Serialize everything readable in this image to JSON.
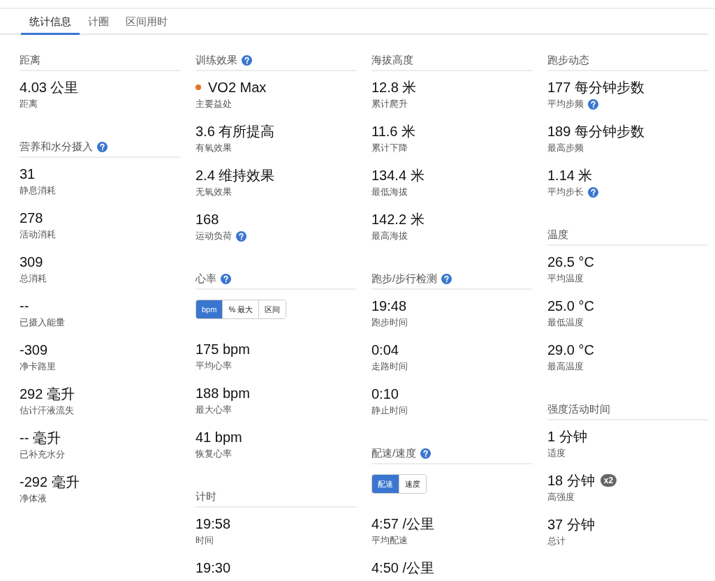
{
  "tabs": [
    {
      "label": "统计信息",
      "selected": true
    },
    {
      "label": "计圈",
      "selected": false
    },
    {
      "label": "区间用时",
      "selected": false
    }
  ],
  "columns": [
    {
      "sections": [
        {
          "title": "距离",
          "stats": [
            {
              "value": "4.03 公里",
              "label": "距离"
            }
          ]
        },
        {
          "title": "营养和水分摄入",
          "help": true,
          "stats": [
            {
              "value": "31",
              "label": "静息消耗"
            },
            {
              "value": "278",
              "label": "活动消耗"
            },
            {
              "value": "309",
              "label": "总消耗"
            },
            {
              "value": "--",
              "label": "已摄入能量"
            },
            {
              "value": "-309",
              "label": "净卡路里"
            },
            {
              "value": "292 毫升",
              "label": "估计汗液流失"
            },
            {
              "value": "-- 毫升",
              "label": "已补充水分"
            },
            {
              "value": "-292 毫升",
              "label": "净体液"
            }
          ]
        }
      ]
    },
    {
      "sections": [
        {
          "title": "训练效果",
          "help": true,
          "stats": [
            {
              "value": "VO2 Max",
              "label": "主要益处",
              "color": "#e8702a"
            },
            {
              "value": "3.6 有所提高",
              "label": "有氧效果"
            },
            {
              "value": "2.4 维持效果",
              "label": "无氧效果"
            },
            {
              "value": "168",
              "label": "运动负荷",
              "help": true
            }
          ]
        },
        {
          "title": "心率",
          "help": true,
          "toggle": [
            {
              "label": "bpm",
              "selected": true
            },
            {
              "label": "% 最大",
              "selected": false
            },
            {
              "label": "区间",
              "selected": false
            }
          ],
          "stats": [
            {
              "value": "175 bpm",
              "label": "平均心率"
            },
            {
              "value": "188 bpm",
              "label": "最大心率"
            },
            {
              "value": "41 bpm",
              "label": "恢复心率"
            }
          ]
        },
        {
          "title": "计时",
          "stats": [
            {
              "value": "19:58",
              "label": "时间"
            },
            {
              "value": "19:30"
            }
          ]
        }
      ]
    },
    {
      "sections": [
        {
          "title": "海拔高度",
          "stats": [
            {
              "value": "12.8 米",
              "label": "累计爬升"
            },
            {
              "value": "11.6 米",
              "label": "累计下降"
            },
            {
              "value": "134.4 米",
              "label": "最低海拔"
            },
            {
              "value": "142.2 米",
              "label": "最高海拔"
            }
          ]
        },
        {
          "title": "跑步/步行检测",
          "help": true,
          "stats": [
            {
              "value": "19:48",
              "label": "跑步时间"
            },
            {
              "value": "0:04",
              "label": "走路时间"
            },
            {
              "value": "0:10",
              "label": "静止时间"
            }
          ]
        },
        {
          "title": "配速/速度",
          "help": true,
          "toggle": [
            {
              "label": "配速",
              "selected": true
            },
            {
              "label": "速度",
              "selected": false
            }
          ],
          "stats": [
            {
              "value": "4:57 /公里",
              "label": "平均配速"
            },
            {
              "value": "4:50 /公里"
            }
          ]
        }
      ]
    },
    {
      "sections": [
        {
          "title": "跑步动态",
          "stats": [
            {
              "value": "177 每分钟步数",
              "label": "平均步频",
              "help": true
            },
            {
              "value": "189 每分钟步数",
              "label": "最高步频"
            },
            {
              "value": "1.14 米",
              "label": "平均步长",
              "help": true
            }
          ]
        },
        {
          "title": "温度",
          "stats": [
            {
              "value": "26.5 °C",
              "label": "平均温度"
            },
            {
              "value": "25.0 °C",
              "label": "最低温度"
            },
            {
              "value": "29.0 °C",
              "label": "最高温度"
            }
          ]
        },
        {
          "title": "强度活动时间",
          "stats": [
            {
              "value": "1 分钟",
              "label": "适度"
            },
            {
              "value": "18 分钟",
              "label": "高强度",
              "badge": "x2"
            },
            {
              "value": "37 分钟",
              "label": "总计"
            }
          ]
        }
      ]
    }
  ]
}
